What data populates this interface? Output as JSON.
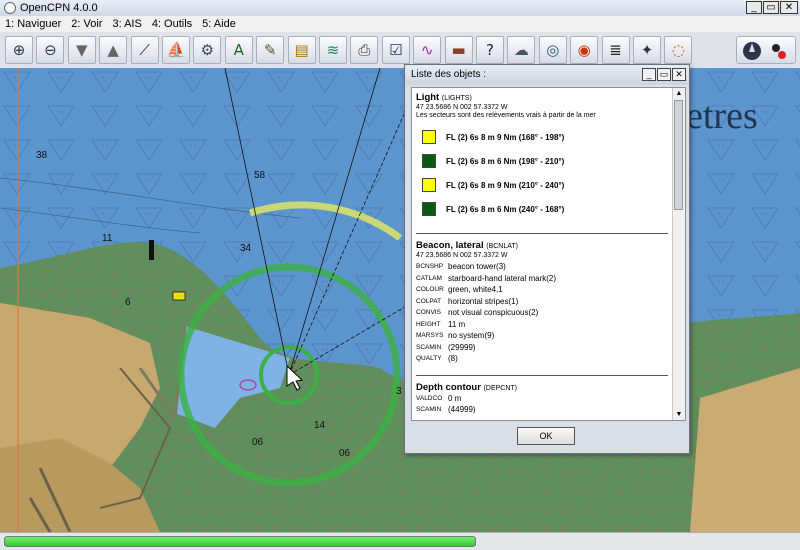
{
  "window": {
    "title": "OpenCPN 4.0.0",
    "min": "_",
    "max": "▭",
    "close": "✕"
  },
  "menu": [
    "1: Naviguer",
    "2: Voir",
    "3: AIS",
    "4: Outils",
    "5: Aide"
  ],
  "toolbar": {
    "icons": [
      "zoom-in-icon",
      "zoom-out-icon",
      "scale-down-icon",
      "scale-up-icon",
      "route-icon",
      "ownship-icon",
      "settings-icon",
      "text-icon",
      "measure-icon",
      "chart-group-icon",
      "tide-icon",
      "print-icon",
      "route-manager-icon",
      "track-icon",
      "ais-icon",
      "help-icon",
      "weather-icon",
      "dashboard-icon",
      "lifebuoy-icon",
      "notes-icon",
      "dog-icon",
      "rescue-icon"
    ],
    "compass": "compass-icon"
  },
  "chart": {
    "depths": [
      "38",
      "58",
      "11",
      "34",
      "6",
      "14",
      "06",
      "06",
      "3"
    ],
    "place_text": "etres",
    "colors": {
      "deep": "#5b8fc9",
      "shallow": "#7fb0e0",
      "land": "#c9ab73",
      "green": "#5a8b55",
      "sector_green": "#3cb043",
      "sector_yellow": "#d6e06c"
    }
  },
  "dialog": {
    "title": "Liste des objets :",
    "light": {
      "name": "Light",
      "code": "(LIGHTS)",
      "position": "47 23.5686 N 002 57.3372 W",
      "note": "Les secteurs sont des relèvements vrais à partir de la mer",
      "sectors": [
        {
          "color": "#ffff00",
          "text": "FL (2) 6s 8 m 9 Nm (168° - 198°)"
        },
        {
          "color": "#0a5a14",
          "text": "FL (2) 6s 8 m 6 Nm (198° - 210°)"
        },
        {
          "color": "#ffff00",
          "text": "FL (2) 6s 8 m 9 Nm (210° - 240°)"
        },
        {
          "color": "#0a5a14",
          "text": "FL (2) 6s 8 m 6 Nm (240° - 168°)"
        }
      ]
    },
    "beacon": {
      "name": "Beacon, lateral",
      "code": "(BCNLAT)",
      "position": "47 23.5686 N 002 57.3372 W",
      "attrs": [
        {
          "k": "BCNSHP",
          "v": "beacon tower(3)"
        },
        {
          "k": "CATLAM",
          "v": "starboard-hand lateral mark(2)"
        },
        {
          "k": "COLOUR",
          "v": "green, white4,1"
        },
        {
          "k": "COLPAT",
          "v": "horizontal stripes(1)"
        },
        {
          "k": "CONVIS",
          "v": "not visual conspicuous(2)"
        },
        {
          "k": "HEIGHT",
          "v": "11 m"
        },
        {
          "k": "MARSYS",
          "v": "no system(9)"
        },
        {
          "k": "SCAMIN",
          "v": "(29999)"
        },
        {
          "k": "QUALTY",
          "v": "(8)"
        }
      ]
    },
    "depth": {
      "name": "Depth contour",
      "code": "(DEPCNT)",
      "attrs": [
        {
          "k": "VALDCO",
          "v": "0 m"
        },
        {
          "k": "SCAMIN",
          "v": "(44999)"
        }
      ]
    },
    "ok": "OK"
  },
  "status": {
    "progress": 0.6
  }
}
